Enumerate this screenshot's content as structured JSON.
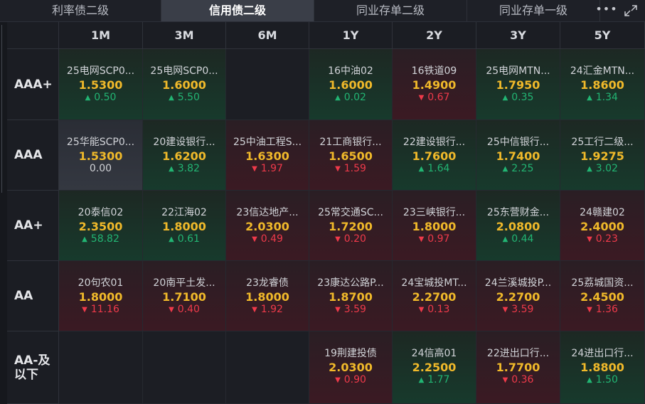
{
  "tabs": [
    {
      "label": "利率债二级",
      "active": false
    },
    {
      "label": "信用债二级",
      "active": true
    },
    {
      "label": "同业存单二级",
      "active": false
    },
    {
      "label": "同业存单一级",
      "active": false
    }
  ],
  "toolbar": {
    "more_icon": "more-dots-icon",
    "expand_icon": "expand-icon"
  },
  "columns": [
    "1M",
    "3M",
    "6M",
    "1Y",
    "2Y",
    "3Y",
    "5Y"
  ],
  "rows": [
    {
      "label": "AAA+",
      "cells": [
        {
          "name": "25电网SCP0...",
          "price": "1.5300",
          "change": "0.50",
          "dir": "up"
        },
        {
          "name": "25电网SCP0...",
          "price": "1.6000",
          "change": "5.50",
          "dir": "up"
        },
        null,
        {
          "name": "16中油02",
          "price": "1.6000",
          "change": "0.02",
          "dir": "up"
        },
        {
          "name": "16铁道09",
          "price": "1.4900",
          "change": "0.67",
          "dir": "down"
        },
        {
          "name": "25电网MTN...",
          "price": "1.7950",
          "change": "0.35",
          "dir": "up"
        },
        {
          "name": "24汇金MTN...",
          "price": "1.8600",
          "change": "1.34",
          "dir": "up"
        }
      ]
    },
    {
      "label": "AAA",
      "cells": [
        {
          "name": "25华能SCP0...",
          "price": "1.5300",
          "change": "0.00",
          "dir": "flat"
        },
        {
          "name": "20建设银行...",
          "price": "1.6200",
          "change": "3.82",
          "dir": "up"
        },
        {
          "name": "25中油工程S...",
          "price": "1.6300",
          "change": "1.97",
          "dir": "down"
        },
        {
          "name": "21工商银行...",
          "price": "1.6500",
          "change": "1.59",
          "dir": "down"
        },
        {
          "name": "22建设银行...",
          "price": "1.7600",
          "change": "1.64",
          "dir": "up"
        },
        {
          "name": "25中信银行...",
          "price": "1.7400",
          "change": "2.25",
          "dir": "up"
        },
        {
          "name": "25工行二级...",
          "price": "1.9275",
          "change": "3.02",
          "dir": "up"
        }
      ]
    },
    {
      "label": "AA+",
      "cells": [
        {
          "name": "20泰信02",
          "price": "2.3500",
          "change": "58.82",
          "dir": "up"
        },
        {
          "name": "22江海02",
          "price": "1.8000",
          "change": "0.61",
          "dir": "up"
        },
        {
          "name": "23信达地产...",
          "price": "2.0300",
          "change": "0.49",
          "dir": "down"
        },
        {
          "name": "25常交通SC...",
          "price": "1.7200",
          "change": "0.20",
          "dir": "down"
        },
        {
          "name": "23三峡银行...",
          "price": "1.8000",
          "change": "0.97",
          "dir": "down"
        },
        {
          "name": "25东营财金...",
          "price": "2.0800",
          "change": "0.44",
          "dir": "up"
        },
        {
          "name": "24赣建02",
          "price": "2.4000",
          "change": "0.23",
          "dir": "down"
        }
      ]
    },
    {
      "label": "AA",
      "cells": [
        {
          "name": "20句农01",
          "price": "1.8000",
          "change": "11.16",
          "dir": "down"
        },
        {
          "name": "20南平土发...",
          "price": "1.7100",
          "change": "0.40",
          "dir": "down"
        },
        {
          "name": "23龙睿债",
          "price": "1.8000",
          "change": "1.92",
          "dir": "down"
        },
        {
          "name": "23康达公路P...",
          "price": "1.8700",
          "change": "3.59",
          "dir": "down"
        },
        {
          "name": "24宝城投MT...",
          "price": "2.2700",
          "change": "0.13",
          "dir": "down"
        },
        {
          "name": "24兰溪城投P...",
          "price": "2.2700",
          "change": "3.59",
          "dir": "down"
        },
        {
          "name": "25荔城国资...",
          "price": "2.4500",
          "change": "1.36",
          "dir": "down"
        }
      ]
    },
    {
      "label": "AA-及以下",
      "label_lines": [
        "AA-及",
        "以下"
      ],
      "cells": [
        null,
        null,
        null,
        {
          "name": "19荆建投债",
          "price": "2.0300",
          "change": "0.90",
          "dir": "down"
        },
        {
          "name": "24信高01",
          "price": "2.2500",
          "change": "1.77",
          "dir": "up"
        },
        {
          "name": "22进出口行...",
          "price": "1.7700",
          "change": "0.36",
          "dir": "down"
        },
        {
          "name": "24进出口行...",
          "price": "1.8800",
          "change": "1.50",
          "dir": "up"
        }
      ]
    }
  ],
  "colors": {
    "up": "#22b573",
    "down": "#ef3a4a",
    "price": "#f0b92a"
  }
}
